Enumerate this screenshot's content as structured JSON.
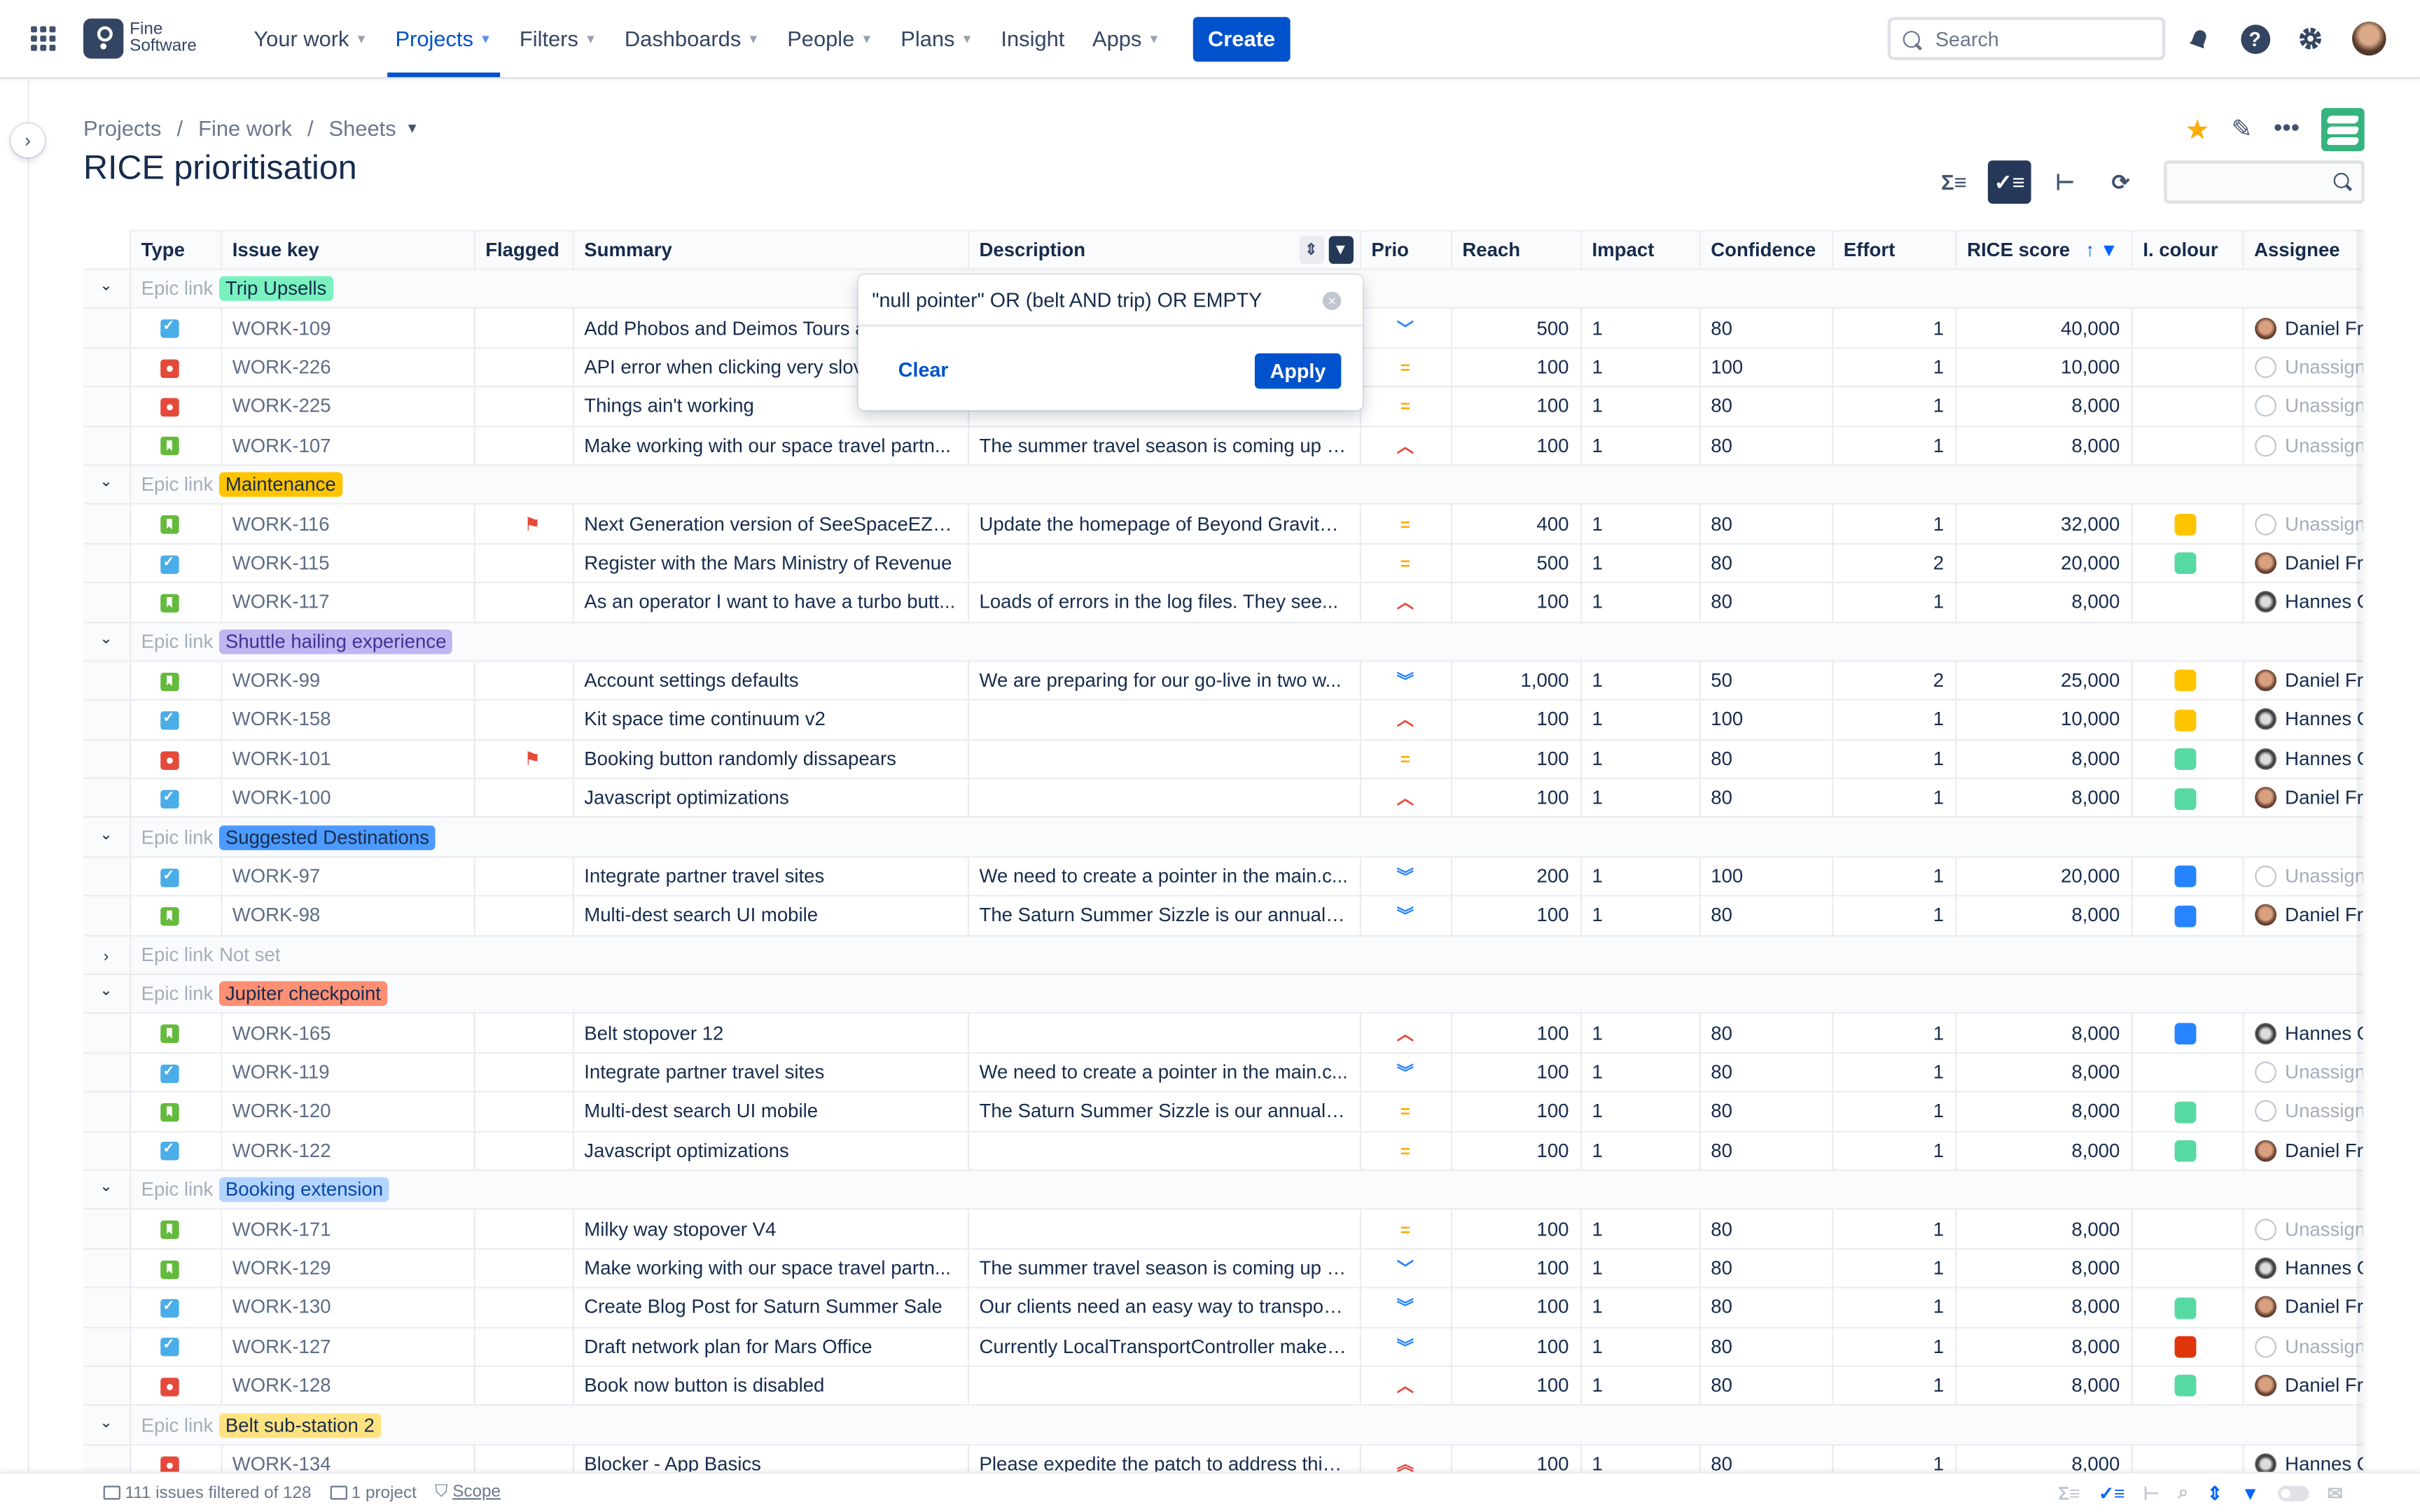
{
  "nav": {
    "logo_line1": "Fine",
    "logo_line2": "Software",
    "items": [
      {
        "label": "Your work",
        "caret": true,
        "active": false
      },
      {
        "label": "Projects",
        "caret": true,
        "active": true
      },
      {
        "label": "Filters",
        "caret": true,
        "active": false
      },
      {
        "label": "Dashboards",
        "caret": true,
        "active": false
      },
      {
        "label": "People",
        "caret": true,
        "active": false
      },
      {
        "label": "Plans",
        "caret": true,
        "active": false
      },
      {
        "label": "Insight",
        "caret": false,
        "active": false
      },
      {
        "label": "Apps",
        "caret": true,
        "active": false
      }
    ],
    "create_label": "Create",
    "search_placeholder": "Search"
  },
  "breadcrumb": [
    "Projects",
    "Fine work",
    "Sheets"
  ],
  "page_title": "RICE prioritisation",
  "columns": [
    "Type",
    "Issue key",
    "Flagged",
    "Summary",
    "Description",
    "Prio",
    "Reach",
    "Impact",
    "Confidence",
    "Effort",
    "RICE score",
    "I. colour",
    "Assignee"
  ],
  "filter_popup": {
    "value": "\"null pointer\" OR (belt AND trip) OR EMPTY",
    "clear_label": "Clear",
    "apply_label": "Apply"
  },
  "epic_link_label": "Epic link",
  "groups": [
    {
      "epic": "Trip Upsells",
      "color": "#79f2c0",
      "expanded": true,
      "rows": [
        {
          "type": "task",
          "key": "WORK-109",
          "flagged": false,
          "summary": "Add Phobos and Deimos Tours a",
          "description": "",
          "prio": "low",
          "reach": "500",
          "impact": "1",
          "confidence": "80",
          "effort": "1",
          "rice": "40,000",
          "colour": "",
          "assignee": "Daniel Fr"
        },
        {
          "type": "bug",
          "key": "WORK-226",
          "flagged": false,
          "summary": "API error when clicking very slov",
          "description": "",
          "prio": "medium",
          "reach": "100",
          "impact": "1",
          "confidence": "100",
          "effort": "1",
          "rice": "10,000",
          "colour": "",
          "assignee": "Unassigned"
        },
        {
          "type": "bug",
          "key": "WORK-225",
          "flagged": false,
          "summary": "Things ain't working",
          "description": "",
          "prio": "medium",
          "reach": "100",
          "impact": "1",
          "confidence": "80",
          "effort": "1",
          "rice": "8,000",
          "colour": "",
          "assignee": "Unassigned"
        },
        {
          "type": "story",
          "key": "WORK-107",
          "flagged": false,
          "summary": "Make working with our space travel partn...",
          "description": "The summer travel season is coming up a...",
          "prio": "high",
          "reach": "100",
          "impact": "1",
          "confidence": "80",
          "effort": "1",
          "rice": "8,000",
          "colour": "",
          "assignee": "Unassigned"
        }
      ]
    },
    {
      "epic": "Maintenance",
      "color": "#ffc400",
      "expanded": true,
      "rows": [
        {
          "type": "story",
          "key": "WORK-116",
          "flagged": true,
          "summary": "Next Generation version of SeeSpaceEZ t...",
          "description": "Update the homepage of Beyond Gravity ...",
          "prio": "medium",
          "reach": "400",
          "impact": "1",
          "confidence": "80",
          "effort": "1",
          "rice": "32,000",
          "colour": "#ffc400",
          "assignee": "Unassigned"
        },
        {
          "type": "task",
          "key": "WORK-115",
          "flagged": false,
          "summary": "Register with the Mars Ministry of Revenue",
          "description": "",
          "prio": "medium",
          "reach": "500",
          "impact": "1",
          "confidence": "80",
          "effort": "2",
          "rice": "20,000",
          "colour": "#57d9a3",
          "assignee": "Daniel Fr"
        },
        {
          "type": "story",
          "key": "WORK-117",
          "flagged": false,
          "summary": "As an operator I want to have a turbo butt...",
          "description": "Loads of errors in the log files. They see...",
          "prio": "high",
          "reach": "100",
          "impact": "1",
          "confidence": "80",
          "effort": "1",
          "rice": "8,000",
          "colour": "",
          "assignee": "Hannes G"
        }
      ]
    },
    {
      "epic": "Shuttle hailing experience",
      "color": "#c0b6f2",
      "expanded": true,
      "rows": [
        {
          "type": "story",
          "key": "WORK-99",
          "flagged": false,
          "summary": "Account settings defaults",
          "description": "We are preparing for our go-live in two w...",
          "prio": "lowest",
          "reach": "1,000",
          "impact": "1",
          "confidence": "50",
          "effort": "2",
          "rice": "25,000",
          "colour": "#ffc400",
          "assignee": "Daniel Fr"
        },
        {
          "type": "task",
          "key": "WORK-158",
          "flagged": false,
          "summary": "Kit space time continuum v2",
          "description": "",
          "prio": "high",
          "reach": "100",
          "impact": "1",
          "confidence": "100",
          "effort": "1",
          "rice": "10,000",
          "colour": "#ffc400",
          "assignee": "Hannes G"
        },
        {
          "type": "bug",
          "key": "WORK-101",
          "flagged": true,
          "summary": "Booking button randomly dissapears",
          "description": "",
          "prio": "medium",
          "reach": "100",
          "impact": "1",
          "confidence": "80",
          "effort": "1",
          "rice": "8,000",
          "colour": "#57d9a3",
          "assignee": "Hannes G"
        },
        {
          "type": "task",
          "key": "WORK-100",
          "flagged": false,
          "summary": "Javascript optimizations",
          "description": "",
          "prio": "high",
          "reach": "100",
          "impact": "1",
          "confidence": "80",
          "effort": "1",
          "rice": "8,000",
          "colour": "#57d9a3",
          "assignee": "Daniel Fr"
        }
      ]
    },
    {
      "epic": "Suggested Destinations",
      "color": "#4c9aff",
      "expanded": true,
      "rows": [
        {
          "type": "task",
          "key": "WORK-97",
          "flagged": false,
          "summary": "Integrate partner travel sites",
          "description": "We need to create a pointer in the main.c...",
          "prio": "lowest",
          "reach": "200",
          "impact": "1",
          "confidence": "100",
          "effort": "1",
          "rice": "20,000",
          "colour": "#2684ff",
          "assignee": "Unassigned"
        },
        {
          "type": "story",
          "key": "WORK-98",
          "flagged": false,
          "summary": "Multi-dest search UI mobile",
          "description": "The Saturn Summer Sizzle is our annual s...",
          "prio": "lowest",
          "reach": "100",
          "impact": "1",
          "confidence": "80",
          "effort": "1",
          "rice": "8,000",
          "colour": "#2684ff",
          "assignee": "Daniel Fr"
        }
      ]
    },
    {
      "epic": "Not set",
      "color": "",
      "expanded": false,
      "rows": []
    },
    {
      "epic": "Jupiter checkpoint",
      "color": "#ff8f73",
      "expanded": true,
      "rows": [
        {
          "type": "story",
          "key": "WORK-165",
          "flagged": false,
          "summary": "Belt stopover 12",
          "description": "",
          "prio": "high",
          "reach": "100",
          "impact": "1",
          "confidence": "80",
          "effort": "1",
          "rice": "8,000",
          "colour": "#2684ff",
          "assignee": "Hannes G"
        },
        {
          "type": "task",
          "key": "WORK-119",
          "flagged": false,
          "summary": "Integrate partner travel sites",
          "description": "We need to create a pointer in the main.c...",
          "prio": "lowest",
          "reach": "100",
          "impact": "1",
          "confidence": "80",
          "effort": "1",
          "rice": "8,000",
          "colour": "",
          "assignee": "Unassigned"
        },
        {
          "type": "story",
          "key": "WORK-120",
          "flagged": false,
          "summary": "Multi-dest search UI mobile",
          "description": "The Saturn Summer Sizzle is our annual s...",
          "prio": "medium",
          "reach": "100",
          "impact": "1",
          "confidence": "80",
          "effort": "1",
          "rice": "8,000",
          "colour": "#57d9a3",
          "assignee": "Unassigned"
        },
        {
          "type": "task",
          "key": "WORK-122",
          "flagged": false,
          "summary": "Javascript optimizations",
          "description": "",
          "prio": "medium",
          "reach": "100",
          "impact": "1",
          "confidence": "80",
          "effort": "1",
          "rice": "8,000",
          "colour": "#57d9a3",
          "assignee": "Daniel Fr"
        }
      ]
    },
    {
      "epic": "Booking extension",
      "color": "#b3d4ff",
      "expanded": true,
      "rows": [
        {
          "type": "story",
          "key": "WORK-171",
          "flagged": false,
          "summary": "Milky way stopover V4",
          "description": "",
          "prio": "medium",
          "reach": "100",
          "impact": "1",
          "confidence": "80",
          "effort": "1",
          "rice": "8,000",
          "colour": "",
          "assignee": "Unassigned"
        },
        {
          "type": "story",
          "key": "WORK-129",
          "flagged": false,
          "summary": "Make working with our space travel partn...",
          "description": "The summer travel season is coming up a...",
          "prio": "low",
          "reach": "100",
          "impact": "1",
          "confidence": "80",
          "effort": "1",
          "rice": "8,000",
          "colour": "",
          "assignee": "Hannes G"
        },
        {
          "type": "task",
          "key": "WORK-130",
          "flagged": false,
          "summary": "Create Blog Post for Saturn Summer Sale",
          "description": "Our clients need an easy way to transport...",
          "prio": "lowest",
          "reach": "100",
          "impact": "1",
          "confidence": "80",
          "effort": "1",
          "rice": "8,000",
          "colour": "#57d9a3",
          "assignee": "Daniel Fr"
        },
        {
          "type": "task",
          "key": "WORK-127",
          "flagged": false,
          "summary": "Draft network plan for Mars Office",
          "description": "Currently LocalTransportController makes...",
          "prio": "lowest",
          "reach": "100",
          "impact": "1",
          "confidence": "80",
          "effort": "1",
          "rice": "8,000",
          "colour": "#de350b",
          "assignee": "Unassigned"
        },
        {
          "type": "bug",
          "key": "WORK-128",
          "flagged": false,
          "summary": "Book now button is disabled",
          "description": "",
          "prio": "high",
          "reach": "100",
          "impact": "1",
          "confidence": "80",
          "effort": "1",
          "rice": "8,000",
          "colour": "#57d9a3",
          "assignee": "Daniel Fr"
        }
      ]
    },
    {
      "epic": "Belt sub-station 2",
      "color": "#ffe380",
      "expanded": true,
      "rows": [
        {
          "type": "bug",
          "key": "WORK-134",
          "flagged": false,
          "summary": "Blocker - App Basics",
          "description": "Please expedite the patch to address this ...",
          "prio": "highest",
          "reach": "100",
          "impact": "1",
          "confidence": "80",
          "effort": "1",
          "rice": "8,000",
          "colour": "",
          "assignee": "Hannes G"
        }
      ]
    }
  ],
  "prio_glyphs": {
    "lowest": "︾",
    "low": "﹀",
    "medium": "=",
    "high": "︿",
    "highest": "︽"
  },
  "footer": {
    "issues_text": "111 issues filtered of 128",
    "project_text": "1 project",
    "scope_label": "Scope"
  }
}
